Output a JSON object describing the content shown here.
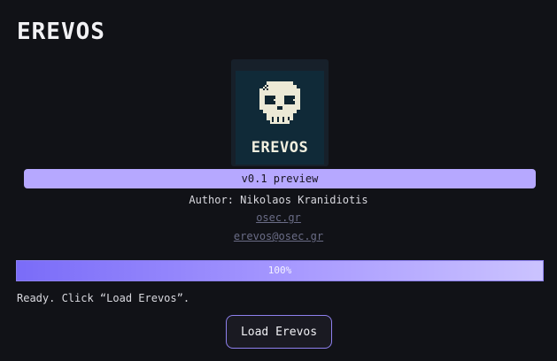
{
  "app": {
    "title": "EREVOS"
  },
  "logo": {
    "text": "EREVOS",
    "icon": "pixel-skull-icon"
  },
  "version": {
    "label": "v0.1 preview"
  },
  "author": {
    "text": "Author: Nikolaos Kranidiotis"
  },
  "links": {
    "site": "osec.gr",
    "email": "erevos@osec.gr"
  },
  "progress": {
    "value": 1.0,
    "label": "100%"
  },
  "status": {
    "text": "Ready. Click “Load Erevos”."
  },
  "actions": {
    "load_label": "Load Erevos"
  },
  "colors": {
    "background": "#111217",
    "accent": "#b6a8ff",
    "progress_start": "#7a6cf8",
    "progress_end": "#cbc3ff",
    "link": "#6a6c86"
  }
}
